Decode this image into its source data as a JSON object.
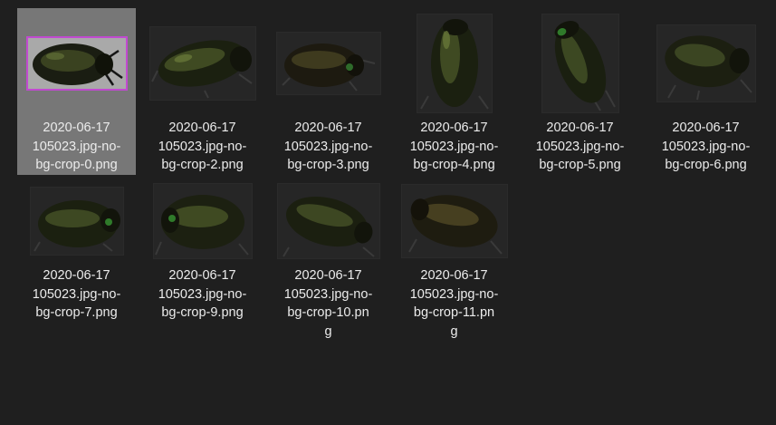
{
  "files": [
    {
      "label": "2020-06-17\n105023.jpg-no-\nbg-crop-0.png",
      "selected": true
    },
    {
      "label": "2020-06-17\n105023.jpg-no-\nbg-crop-2.png",
      "selected": false
    },
    {
      "label": "2020-06-17\n105023.jpg-no-\nbg-crop-3.png",
      "selected": false
    },
    {
      "label": "2020-06-17\n105023.jpg-no-\nbg-crop-4.png",
      "selected": false
    },
    {
      "label": "2020-06-17\n105023.jpg-no-\nbg-crop-5.png",
      "selected": false
    },
    {
      "label": "2020-06-17\n105023.jpg-no-\nbg-crop-6.png",
      "selected": false
    },
    {
      "label": "2020-06-17\n105023.jpg-no-\nbg-crop-7.png",
      "selected": false
    },
    {
      "label": "2020-06-17\n105023.jpg-no-\nbg-crop-9.png",
      "selected": false
    },
    {
      "label": "2020-06-17\n105023.jpg-no-\nbg-crop-10.pn\ng",
      "selected": false
    },
    {
      "label": "2020-06-17\n105023.jpg-no-\nbg-crop-11.pn\ng",
      "selected": false
    }
  ],
  "colors": {
    "background": "#1f1f1f",
    "selection": "#777777",
    "selection_outline": "#c14ad0",
    "text": "#ececec"
  }
}
